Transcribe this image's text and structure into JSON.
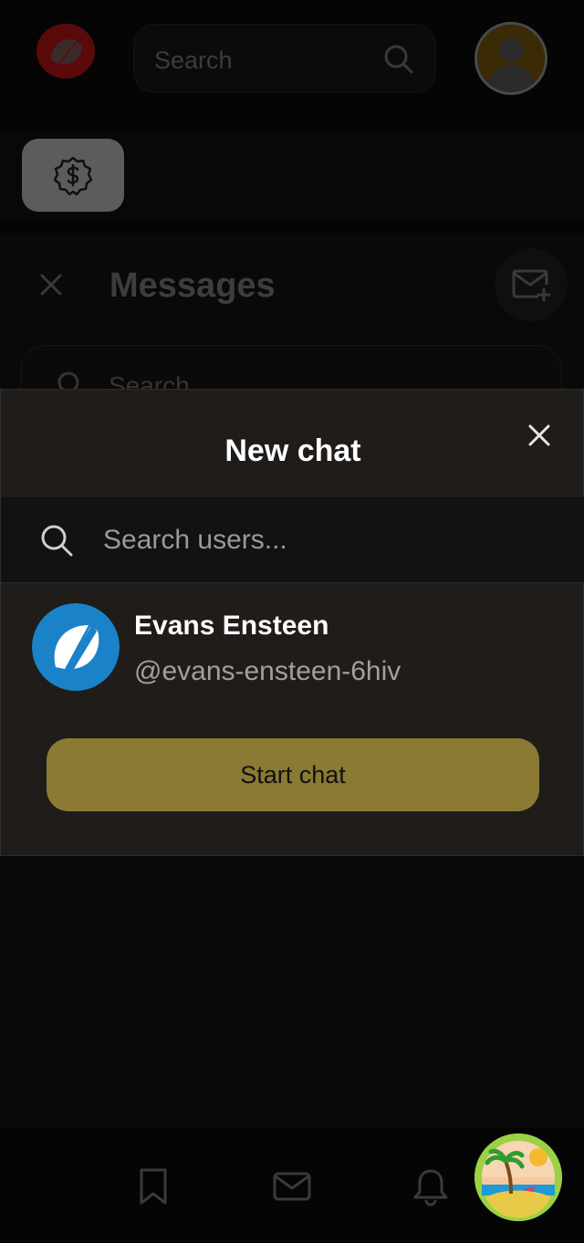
{
  "header": {
    "search_placeholder": "Search"
  },
  "messages_panel": {
    "title": "Messages",
    "search_placeholder": "Search"
  },
  "modal": {
    "title": "New chat",
    "search_placeholder": "Search users...",
    "search_value": "",
    "user": {
      "name": "Evans Ensteen",
      "handle": "@evans-ensteen-6hiv"
    },
    "start_button": "Start chat"
  },
  "icons": {
    "logo": "logo-icon",
    "search": "search-icon",
    "profile": "user-avatar-icon",
    "dollar": "dollar-badge-icon",
    "close": "close-icon",
    "new_message": "new-message-icon",
    "bookmark": "bookmark-icon",
    "mail": "mail-icon",
    "bell": "bell-icon"
  },
  "colors": {
    "background": "#050505",
    "modal_background": "#1f1c1a",
    "accent_button": "#8a7a33",
    "avatar_blue": "#1a82c8"
  }
}
